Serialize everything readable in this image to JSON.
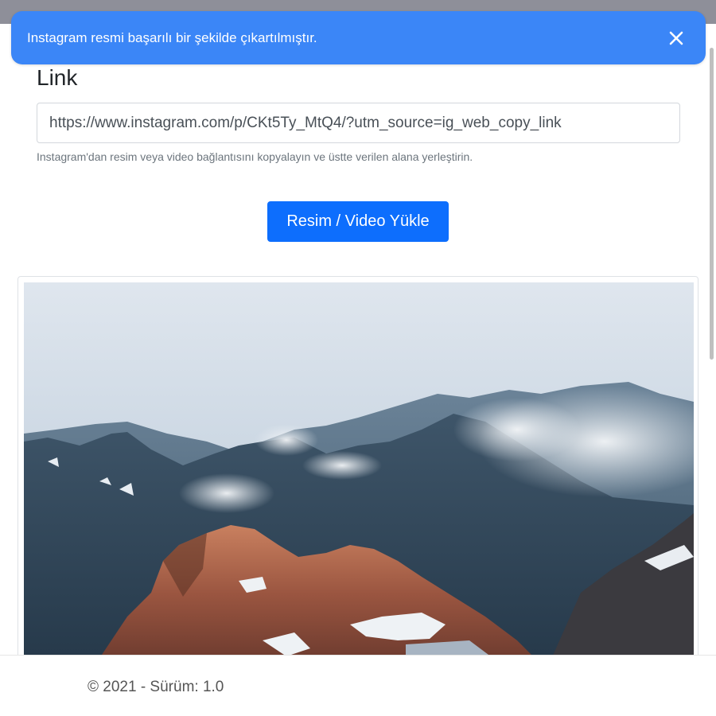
{
  "toast": {
    "message": "Instagram resmi başarılı bir şekilde çıkartılmıştır.",
    "close_icon": "close-icon",
    "background": "#3b86f7"
  },
  "form": {
    "label": "Link",
    "url_value": "https://www.instagram.com/p/CKt5Ty_MtQ4/?utm_source=ig_web_copy_link",
    "help_text": "Instagram'dan resim veya video bağlantısını kopyalayın ve üstte verilen alana yerleştirin.",
    "submit_label": "Resim / Video Yükle",
    "submit_color": "#0d6efd"
  },
  "preview": {
    "image_icon": "mountain-landscape-image"
  },
  "footer": {
    "text": "© 2021 - Sürüm: 1.0"
  }
}
